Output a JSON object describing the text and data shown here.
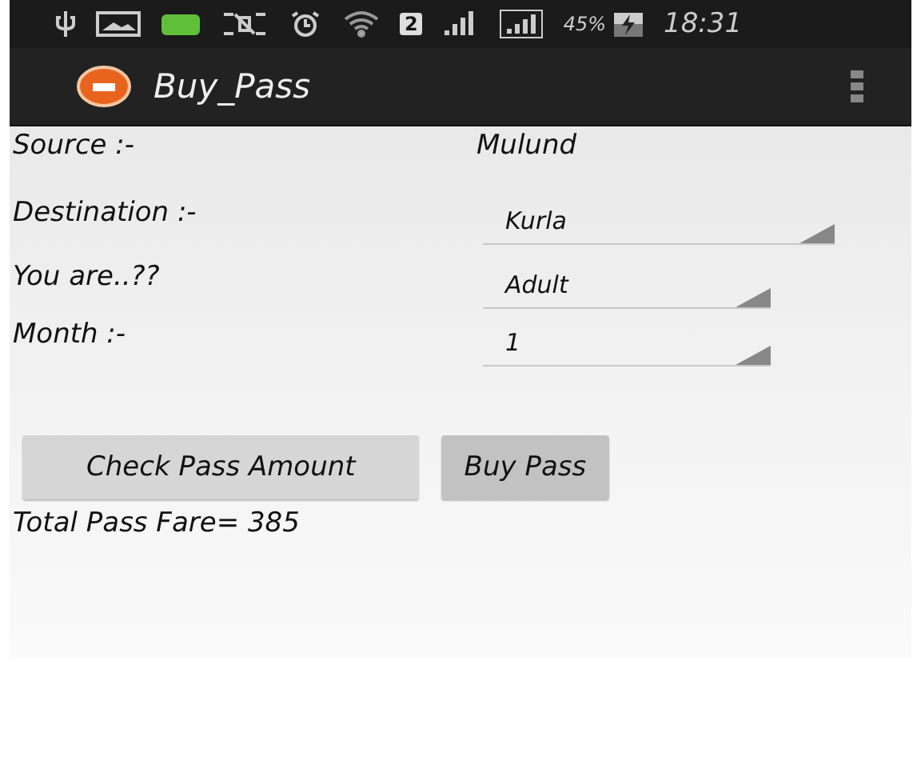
{
  "status_bar": {
    "sim_slot": "2",
    "battery": "45%",
    "time": "18:31"
  },
  "action_bar": {
    "title": "Buy_Pass"
  },
  "form": {
    "source_label": "Source :-",
    "source_value": "Mulund",
    "fields": [
      {
        "label": "Destination :-",
        "value": "Kurla",
        "wide": true
      },
      {
        "label": "You are..??",
        "value": "Adult",
        "wide": false
      },
      {
        "label": "Month :-",
        "value": "1",
        "wide": false
      }
    ]
  },
  "buttons": [
    {
      "label": "Check Pass Amount",
      "pressed": false
    },
    {
      "label": "Buy Pass",
      "pressed": true
    }
  ],
  "result": "Total Pass Fare= 385"
}
